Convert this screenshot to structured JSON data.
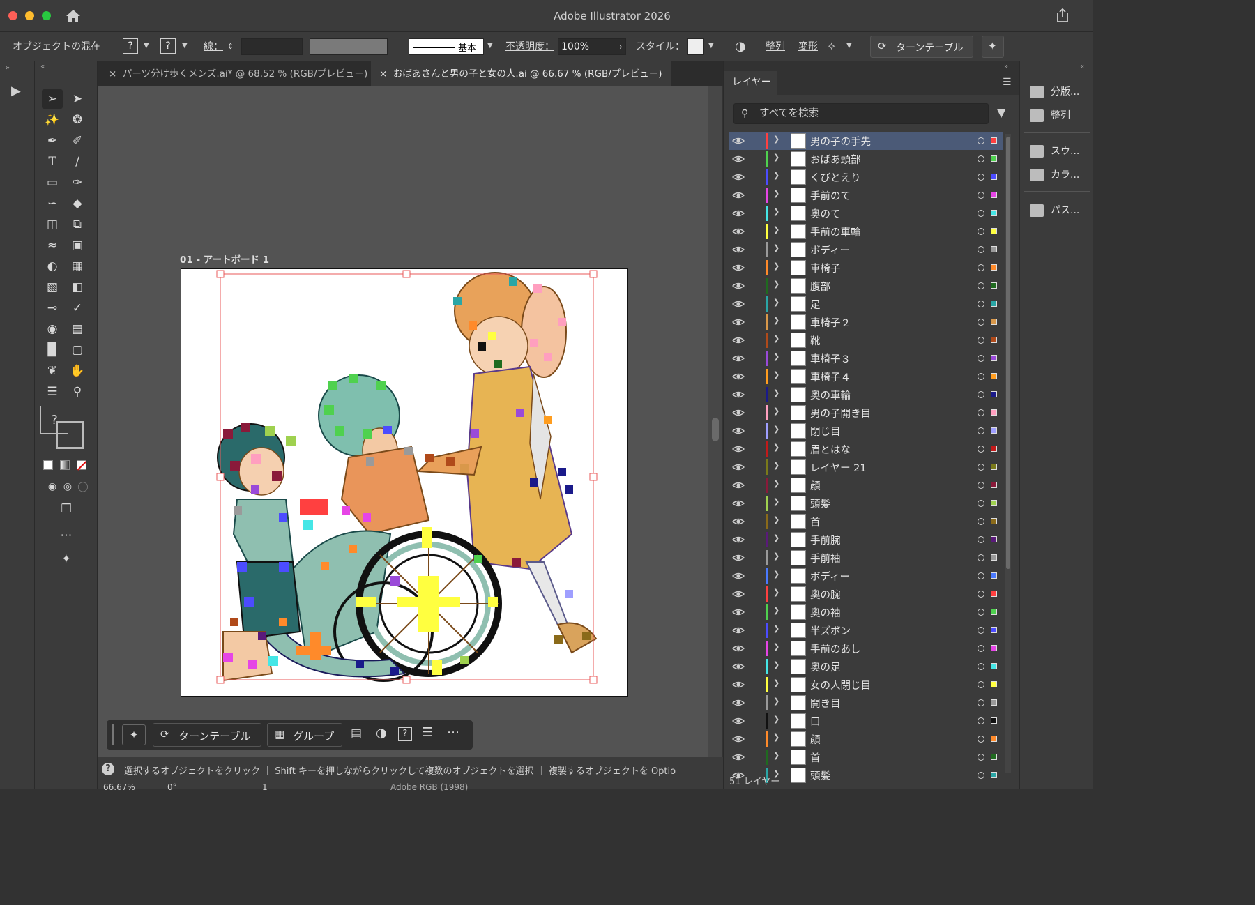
{
  "window": {
    "title": "Adobe Illustrator 2026"
  },
  "control_bar": {
    "selection_label": "オブジェクトの混在",
    "stroke_label": "線：",
    "stroke_style": "基本",
    "opacity_label": "不透明度：",
    "opacity_value": "100%",
    "style_label": "スタイル：",
    "align_label": "整列",
    "transform_label": "変形",
    "turntable_label": "ターンテーブル"
  },
  "tabs": [
    {
      "label": "パーツ分け歩くメンズ.ai* @ 68.52 % (RGB/プレビュー)",
      "active": false
    },
    {
      "label": "おばあさんと男の子と女の人.ai @ 66.67 % (RGB/プレビュー)",
      "active": true
    }
  ],
  "artboard": {
    "label": "01 - アートボード 1"
  },
  "context_bar": {
    "turntable_label": "ターンテーブル",
    "group_label": "グループ"
  },
  "status": {
    "hint": "選択するオブジェクトをクリック ｜ Shift キーを押しながらクリックして複数のオブジェクトを選択 ｜ 複製するオブジェクトを Optio",
    "zoom": "66.67%",
    "rotation": "0°",
    "artboard_index": "1",
    "color_profile": "Adobe RGB (1998)"
  },
  "layers_panel": {
    "tab_label": "レイヤー",
    "search_placeholder": "すべてを検索",
    "footer_count": "51 レイヤー",
    "layers": [
      {
        "name": "男の子の手先",
        "color": "#ff4040",
        "selected": true
      },
      {
        "name": "おばあ頭部",
        "color": "#4fd14f"
      },
      {
        "name": "くびとえり",
        "color": "#4c4cff"
      },
      {
        "name": "手前のて",
        "color": "#e645e6"
      },
      {
        "name": "奥のて",
        "color": "#45e6e6"
      },
      {
        "name": "手前の車輪",
        "color": "#ffff40"
      },
      {
        "name": "ボディー",
        "color": "#9a9a9a"
      },
      {
        "name": "車椅子",
        "color": "#ff8a2a"
      },
      {
        "name": "腹部",
        "color": "#1f6b1f"
      },
      {
        "name": "足",
        "color": "#2aa6a6"
      },
      {
        "name": "車椅子２",
        "color": "#d9984a"
      },
      {
        "name": "靴",
        "color": "#b04a1a"
      },
      {
        "name": "車椅子３",
        "color": "#9a4ad9"
      },
      {
        "name": "車椅子４",
        "color": "#ff9d1f"
      },
      {
        "name": "奥の車輪",
        "color": "#1a1a8a"
      },
      {
        "name": "男の子開き目",
        "color": "#ff9fbf"
      },
      {
        "name": "閉じ目",
        "color": "#9f9fff"
      },
      {
        "name": "眉とはな",
        "color": "#c21a1a"
      },
      {
        "name": "レイヤー 21",
        "color": "#7a7a1a"
      },
      {
        "name": "顔",
        "color": "#8a1a3a"
      },
      {
        "name": "頭髪",
        "color": "#9fd14f"
      },
      {
        "name": "首",
        "color": "#8a6a1a"
      },
      {
        "name": "手前腕",
        "color": "#5a1a7a"
      },
      {
        "name": "手前袖",
        "color": "#9a9a9a"
      },
      {
        "name": "ボディー",
        "color": "#4a7aff"
      },
      {
        "name": "奥の腕",
        "color": "#ff4040"
      },
      {
        "name": "奥の袖",
        "color": "#4fd14f"
      },
      {
        "name": "半ズボン",
        "color": "#4c4cff"
      },
      {
        "name": "手前のあし",
        "color": "#e645e6"
      },
      {
        "name": "奥の足",
        "color": "#45e6e6"
      },
      {
        "name": "女の人閉じ目",
        "color": "#ffff40"
      },
      {
        "name": "開き目",
        "color": "#9a9a9a"
      },
      {
        "name": "口",
        "color": "#111111"
      },
      {
        "name": "顔",
        "color": "#ff8a2a"
      },
      {
        "name": "首",
        "color": "#1f6b1f"
      },
      {
        "name": "頭髪",
        "color": "#2aa6a6"
      }
    ]
  },
  "right_panel": {
    "items": [
      "分版...",
      "整列",
      "スウ...",
      "カラ...",
      "パス..."
    ]
  },
  "icons": [
    "home-icon",
    "share-icon",
    "selection-tool-icon",
    "pen-tool-icon",
    "type-tool-icon",
    "eye-icon",
    "search-icon",
    "filter-icon",
    "hand-tool-icon",
    "zoom-tool-icon"
  ]
}
